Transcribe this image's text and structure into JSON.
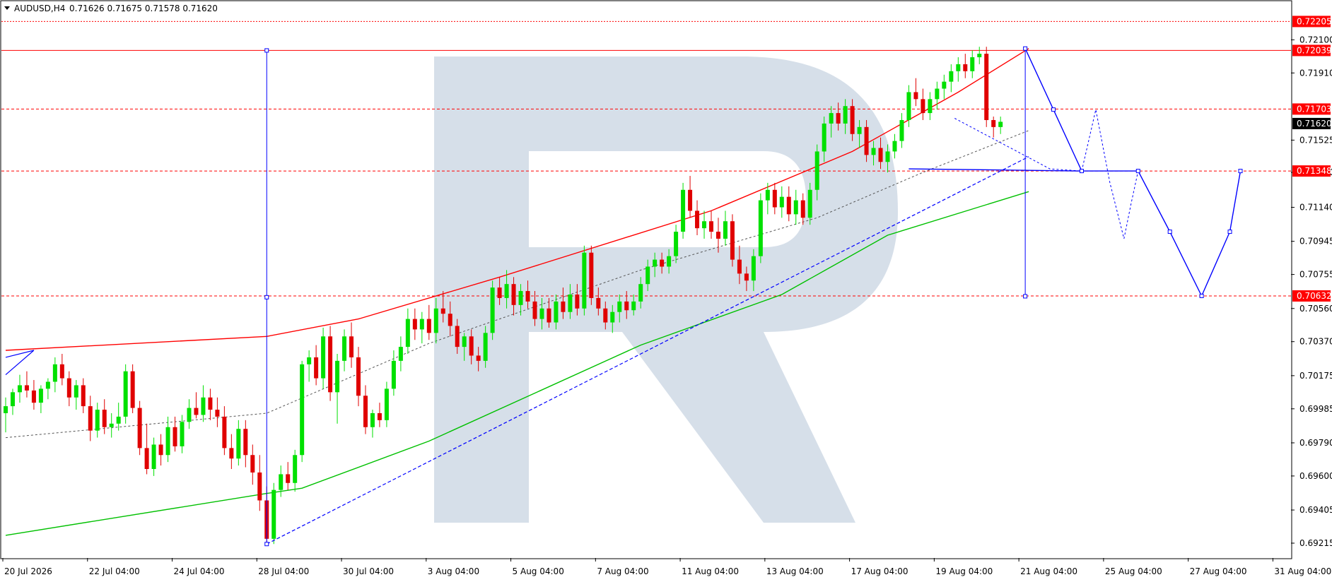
{
  "header": {
    "symbol": "AUDUSD,H4",
    "ohlc": "0.71626 0.71675 0.71578 0.71620"
  },
  "colors": {
    "bull": "#00e000",
    "bear": "#e00000",
    "grid_ref": "#ff0000",
    "projection": "#0000ff",
    "upper_band": "#ff0000",
    "lower_band": "#00c000",
    "watermark": "#d6dfe9"
  },
  "chart_data": {
    "type": "candlestick",
    "symbol": "AUDUSD",
    "timeframe": "H4",
    "ylim": [
      0.6913,
      0.7232
    ],
    "y_ticks": [
      "0.72100",
      "0.71910",
      "0.71525",
      "0.71340",
      "0.71140",
      "0.70945",
      "0.70755",
      "0.70560",
      "0.70370",
      "0.70175",
      "0.69985",
      "0.69790",
      "0.69600",
      "0.69405",
      "0.69215"
    ],
    "x_ticks": [
      "20 Jul 2026",
      "22 Jul 04:00",
      "24 Jul 04:00",
      "28 Jul 04:00",
      "30 Jul 04:00",
      "3 Aug 04:00",
      "5 Aug 04:00",
      "7 Aug 04:00",
      "11 Aug 04:00",
      "13 Aug 04:00",
      "17 Aug 04:00",
      "19 Aug 04:00",
      "21 Aug 04:00",
      "25 Aug 04:00",
      "27 Aug 04:00",
      "31 Aug 04:00"
    ],
    "price_labels": [
      {
        "text": "0.72205",
        "value": 0.72205,
        "color": "#ff0000",
        "fill": "#ff0000"
      },
      {
        "text": "0.72039",
        "value": 0.72039,
        "color": "#ff0000",
        "fill": "#ff0000"
      },
      {
        "text": "0.71703",
        "value": 0.71703,
        "color": "#ff0000",
        "fill": "#ff0000"
      },
      {
        "text": "0.71620",
        "value": 0.7162,
        "color": "#000000",
        "fill": "#000000"
      },
      {
        "text": "0.71348",
        "value": 0.71348,
        "color": "#ff0000",
        "fill": "#ff0000"
      },
      {
        "text": "0.70632",
        "value": 0.70632,
        "color": "#ff0000",
        "fill": "#ff0000"
      }
    ],
    "levels": [
      {
        "value": 0.72205,
        "style": "dotted"
      },
      {
        "value": 0.72039,
        "style": "solid"
      },
      {
        "value": 0.71703,
        "style": "dashed"
      },
      {
        "value": 0.71348,
        "style": "dashed"
      },
      {
        "value": 0.70632,
        "style": "dashed"
      }
    ],
    "candles": [
      [
        0.6996,
        0.7005,
        0.6985,
        0.7
      ],
      [
        0.7,
        0.701,
        0.6995,
        0.7008
      ],
      [
        0.7008,
        0.7018,
        0.7002,
        0.7012
      ],
      [
        0.7012,
        0.702,
        0.7005,
        0.7009
      ],
      [
        0.7009,
        0.7015,
        0.6998,
        0.7002
      ],
      [
        0.7002,
        0.7012,
        0.6996,
        0.701
      ],
      [
        0.701,
        0.7016,
        0.7004,
        0.7014
      ],
      [
        0.7014,
        0.7028,
        0.7008,
        0.7024
      ],
      [
        0.7024,
        0.703,
        0.7012,
        0.7016
      ],
      [
        0.7016,
        0.702,
        0.7,
        0.7005
      ],
      [
        0.7005,
        0.7015,
        0.6998,
        0.7012
      ],
      [
        0.7012,
        0.7016,
        0.6996,
        0.7
      ],
      [
        0.7,
        0.7006,
        0.698,
        0.6986
      ],
      [
        0.6986,
        0.7002,
        0.6982,
        0.6998
      ],
      [
        0.6998,
        0.7004,
        0.6984,
        0.6988
      ],
      [
        0.6988,
        0.6996,
        0.6982,
        0.699
      ],
      [
        0.699,
        0.7002,
        0.6986,
        0.6994
      ],
      [
        0.6994,
        0.7024,
        0.699,
        0.702
      ],
      [
        0.702,
        0.7024,
        0.6996,
        0.6999
      ],
      [
        0.6999,
        0.7003,
        0.6972,
        0.6976
      ],
      [
        0.6976,
        0.699,
        0.6961,
        0.6964
      ],
      [
        0.6964,
        0.6982,
        0.696,
        0.6978
      ],
      [
        0.6978,
        0.6984,
        0.6966,
        0.6972
      ],
      [
        0.6972,
        0.6994,
        0.6968,
        0.6988
      ],
      [
        0.6988,
        0.6994,
        0.6974,
        0.6977
      ],
      [
        0.6977,
        0.6995,
        0.6973,
        0.6991
      ],
      [
        0.6991,
        0.7004,
        0.6987,
        0.6999
      ],
      [
        0.6999,
        0.7008,
        0.6993,
        0.6995
      ],
      [
        0.6995,
        0.7012,
        0.6991,
        0.7005
      ],
      [
        0.7005,
        0.701,
        0.6992,
        0.6998
      ],
      [
        0.6998,
        0.7005,
        0.6988,
        0.6994
      ],
      [
        0.6994,
        0.7,
        0.6972,
        0.6976
      ],
      [
        0.6976,
        0.6984,
        0.6964,
        0.697
      ],
      [
        0.697,
        0.6992,
        0.6966,
        0.6987
      ],
      [
        0.6987,
        0.6992,
        0.6965,
        0.6972
      ],
      [
        0.6972,
        0.6978,
        0.6955,
        0.6962
      ],
      [
        0.6962,
        0.6972,
        0.694,
        0.6946
      ],
      [
        0.6946,
        0.6954,
        0.692,
        0.6924
      ],
      [
        0.6924,
        0.6956,
        0.6921,
        0.6952
      ],
      [
        0.6952,
        0.6966,
        0.6948,
        0.6961
      ],
      [
        0.6961,
        0.6968,
        0.6952,
        0.6956
      ],
      [
        0.6956,
        0.6975,
        0.6951,
        0.6972
      ],
      [
        0.6972,
        0.7026,
        0.6968,
        0.7024
      ],
      [
        0.7024,
        0.7032,
        0.7014,
        0.7028
      ],
      [
        0.7028,
        0.7035,
        0.7012,
        0.7016
      ],
      [
        0.7016,
        0.7045,
        0.701,
        0.704
      ],
      [
        0.704,
        0.7046,
        0.7003,
        0.7008
      ],
      [
        0.7008,
        0.703,
        0.699,
        0.7026
      ],
      [
        0.7026,
        0.7044,
        0.702,
        0.704
      ],
      [
        0.704,
        0.7048,
        0.7022,
        0.7028
      ],
      [
        0.7028,
        0.7034,
        0.7,
        0.7006
      ],
      [
        0.7006,
        0.7012,
        0.6984,
        0.6988
      ],
      [
        0.6988,
        0.6998,
        0.6982,
        0.6996
      ],
      [
        0.6996,
        0.7002,
        0.6988,
        0.6992
      ],
      [
        0.6992,
        0.7014,
        0.6988,
        0.701
      ],
      [
        0.701,
        0.7032,
        0.7006,
        0.7026
      ],
      [
        0.7026,
        0.704,
        0.702,
        0.7034
      ],
      [
        0.7034,
        0.7056,
        0.703,
        0.705
      ],
      [
        0.705,
        0.7056,
        0.7038,
        0.7044
      ],
      [
        0.7044,
        0.7054,
        0.7036,
        0.705
      ],
      [
        0.705,
        0.7058,
        0.7038,
        0.7042
      ],
      [
        0.7042,
        0.7062,
        0.7036,
        0.7056
      ],
      [
        0.7056,
        0.7066,
        0.7048,
        0.7053
      ],
      [
        0.7053,
        0.706,
        0.704,
        0.7046
      ],
      [
        0.7046,
        0.705,
        0.703,
        0.7034
      ],
      [
        0.7034,
        0.7042,
        0.7026,
        0.704
      ],
      [
        0.704,
        0.7044,
        0.7024,
        0.7029
      ],
      [
        0.7029,
        0.7034,
        0.702,
        0.7026
      ],
      [
        0.7026,
        0.7046,
        0.7022,
        0.7042
      ],
      [
        0.7042,
        0.7072,
        0.7038,
        0.7068
      ],
      [
        0.7068,
        0.7074,
        0.7058,
        0.7062
      ],
      [
        0.7062,
        0.7078,
        0.7056,
        0.707
      ],
      [
        0.707,
        0.7074,
        0.7052,
        0.7058
      ],
      [
        0.7058,
        0.707,
        0.7052,
        0.7066
      ],
      [
        0.7066,
        0.7072,
        0.7056,
        0.706
      ],
      [
        0.706,
        0.7066,
        0.7046,
        0.705
      ],
      [
        0.705,
        0.7062,
        0.7044,
        0.7056
      ],
      [
        0.7056,
        0.7062,
        0.7045,
        0.7048
      ],
      [
        0.7048,
        0.7064,
        0.7044,
        0.706
      ],
      [
        0.706,
        0.7068,
        0.705,
        0.7054
      ],
      [
        0.7054,
        0.707,
        0.705,
        0.7064
      ],
      [
        0.7064,
        0.707,
        0.7052,
        0.7056
      ],
      [
        0.7056,
        0.7092,
        0.7052,
        0.7088
      ],
      [
        0.7088,
        0.7092,
        0.7058,
        0.7062
      ],
      [
        0.7062,
        0.7068,
        0.7052,
        0.7056
      ],
      [
        0.7056,
        0.706,
        0.7044,
        0.7048
      ],
      [
        0.7048,
        0.7058,
        0.7042,
        0.7054
      ],
      [
        0.7054,
        0.7064,
        0.7048,
        0.706
      ],
      [
        0.706,
        0.7066,
        0.705,
        0.7055
      ],
      [
        0.7055,
        0.7064,
        0.7052,
        0.706
      ],
      [
        0.706,
        0.7074,
        0.7056,
        0.707
      ],
      [
        0.707,
        0.7084,
        0.7066,
        0.708
      ],
      [
        0.708,
        0.7088,
        0.7074,
        0.7084
      ],
      [
        0.7084,
        0.7088,
        0.7076,
        0.708
      ],
      [
        0.708,
        0.709,
        0.7076,
        0.7086
      ],
      [
        0.7086,
        0.7104,
        0.7082,
        0.71
      ],
      [
        0.71,
        0.7128,
        0.7096,
        0.7124
      ],
      [
        0.7124,
        0.7132,
        0.7108,
        0.7112
      ],
      [
        0.7112,
        0.7118,
        0.7098,
        0.7102
      ],
      [
        0.7102,
        0.7112,
        0.7096,
        0.7106
      ],
      [
        0.7106,
        0.7112,
        0.7096,
        0.71
      ],
      [
        0.71,
        0.7108,
        0.7088,
        0.7096
      ],
      [
        0.7096,
        0.7112,
        0.7092,
        0.7106
      ],
      [
        0.7106,
        0.711,
        0.708,
        0.7084
      ],
      [
        0.7084,
        0.7092,
        0.707,
        0.7076
      ],
      [
        0.7076,
        0.708,
        0.7066,
        0.7072
      ],
      [
        0.7072,
        0.709,
        0.7066,
        0.7086
      ],
      [
        0.7086,
        0.7122,
        0.7082,
        0.7118
      ],
      [
        0.7118,
        0.7128,
        0.711,
        0.7124
      ],
      [
        0.7124,
        0.7128,
        0.711,
        0.7114
      ],
      [
        0.7114,
        0.7126,
        0.7108,
        0.712
      ],
      [
        0.712,
        0.7126,
        0.7106,
        0.711
      ],
      [
        0.711,
        0.7124,
        0.7104,
        0.7118
      ],
      [
        0.7118,
        0.7122,
        0.7104,
        0.7108
      ],
      [
        0.7108,
        0.7128,
        0.7104,
        0.7124
      ],
      [
        0.7124,
        0.715,
        0.7118,
        0.7146
      ],
      [
        0.7146,
        0.7166,
        0.714,
        0.7162
      ],
      [
        0.7162,
        0.7172,
        0.7154,
        0.7168
      ],
      [
        0.7168,
        0.7174,
        0.7158,
        0.7162
      ],
      [
        0.7162,
        0.7176,
        0.7156,
        0.7172
      ],
      [
        0.7172,
        0.7176,
        0.7152,
        0.7156
      ],
      [
        0.7156,
        0.7164,
        0.7148,
        0.716
      ],
      [
        0.716,
        0.7164,
        0.714,
        0.7144
      ],
      [
        0.7144,
        0.7152,
        0.7138,
        0.7148
      ],
      [
        0.7148,
        0.7154,
        0.7136,
        0.714
      ],
      [
        0.714,
        0.715,
        0.7134,
        0.7146
      ],
      [
        0.7146,
        0.7156,
        0.7142,
        0.7152
      ],
      [
        0.7152,
        0.7168,
        0.7148,
        0.7164
      ],
      [
        0.7164,
        0.7184,
        0.716,
        0.718
      ],
      [
        0.718,
        0.7188,
        0.7172,
        0.7176
      ],
      [
        0.7176,
        0.7182,
        0.7164,
        0.7168
      ],
      [
        0.7168,
        0.718,
        0.7164,
        0.7176
      ],
      [
        0.7176,
        0.7186,
        0.717,
        0.7182
      ],
      [
        0.7182,
        0.719,
        0.7176,
        0.7186
      ],
      [
        0.7186,
        0.7196,
        0.718,
        0.7192
      ],
      [
        0.7192,
        0.72,
        0.7186,
        0.7196
      ],
      [
        0.7196,
        0.7202,
        0.7188,
        0.7192
      ],
      [
        0.7192,
        0.7204,
        0.7188,
        0.72
      ],
      [
        0.72,
        0.7206,
        0.7196,
        0.7202
      ],
      [
        0.7202,
        0.7206,
        0.716,
        0.7164
      ],
      [
        0.7164,
        0.7166,
        0.7154,
        0.716
      ],
      [
        0.716,
        0.7166,
        0.7156,
        0.7163
      ]
    ],
    "upper_band": [
      [
        0,
        0.7032
      ],
      [
        37,
        0.704
      ],
      [
        50,
        0.705
      ],
      [
        70,
        0.7074
      ],
      [
        100,
        0.7112
      ],
      [
        120,
        0.7146
      ],
      [
        135,
        0.718
      ],
      [
        145,
        0.7205
      ]
    ],
    "middle_line": [
      [
        0,
        0.6982
      ],
      [
        37,
        0.6996
      ],
      [
        60,
        0.7036
      ],
      [
        90,
        0.7078
      ],
      [
        115,
        0.7108
      ],
      [
        130,
        0.7134
      ],
      [
        145,
        0.7158
      ]
    ],
    "lower_band": [
      [
        0,
        0.6926
      ],
      [
        37,
        0.695
      ],
      [
        42,
        0.6953
      ],
      [
        60,
        0.698
      ],
      [
        90,
        0.7035
      ],
      [
        110,
        0.7064
      ],
      [
        125,
        0.7098
      ],
      [
        145,
        0.7123
      ]
    ],
    "trendline": [
      [
        37,
        0.6921
      ],
      [
        145,
        0.7143
      ]
    ],
    "projection_vertical_left": {
      "x": 37,
      "top": 0.72039,
      "bottom": 0.6921
    },
    "projection_vertical_right": {
      "x": 144.5,
      "top": 0.7205,
      "bottom": 0.7063
    },
    "projection_path": [
      [
        144.5,
        0.7205
      ],
      [
        148.5,
        0.717
      ],
      [
        152.5,
        0.71348
      ],
      [
        160.5,
        0.71348
      ],
      [
        165,
        0.71
      ],
      [
        169.5,
        0.70632
      ],
      [
        173.5,
        0.71
      ],
      [
        175,
        0.71348
      ]
    ],
    "projection_dotted": [
      [
        152.5,
        0.71348
      ],
      [
        154.5,
        0.717
      ],
      [
        156.5,
        0.7128
      ],
      [
        158.5,
        0.7096
      ],
      [
        159.5,
        0.7116
      ],
      [
        160.5,
        0.71348
      ]
    ],
    "support_line": [
      [
        128,
        0.7136
      ],
      [
        152.5,
        0.71348
      ]
    ],
    "triangle_dotted": [
      [
        134.5,
        0.7165
      ],
      [
        148,
        0.7136
      ],
      [
        152.5,
        0.71348
      ]
    ],
    "early_blue": [
      [
        0,
        0.7028
      ],
      [
        4,
        0.7032
      ],
      [
        0,
        0.7018
      ]
    ]
  }
}
